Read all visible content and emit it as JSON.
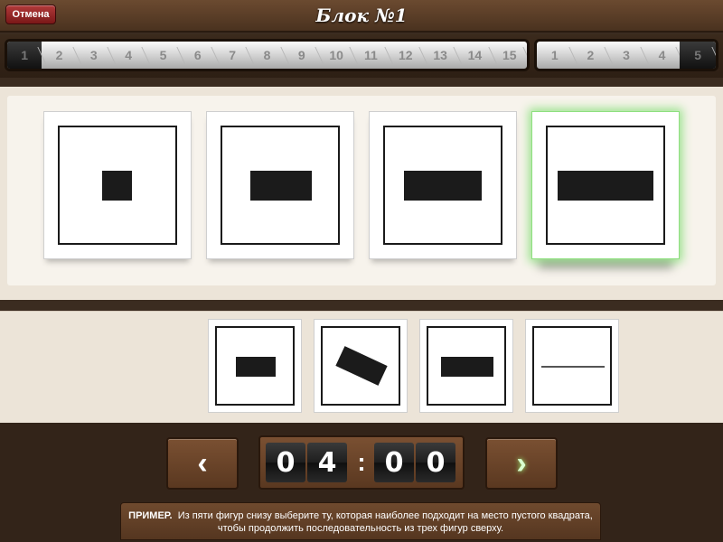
{
  "header": {
    "cancel_label": "Отмена",
    "title": "Блок №1"
  },
  "progress": {
    "main_steps": [
      "1",
      "2",
      "3",
      "4",
      "5",
      "6",
      "7",
      "8",
      "9",
      "10",
      "11",
      "12",
      "13",
      "14",
      "15"
    ],
    "main_active_index": 0,
    "sub_steps": [
      "1",
      "2",
      "3",
      "4",
      "5"
    ],
    "sub_active_index": 4
  },
  "sequence": {
    "highlighted_index": 3
  },
  "timer": {
    "d1": "0",
    "d2": "4",
    "colon": ":",
    "d3": "0",
    "d4": "0"
  },
  "nav": {
    "prev_symbol": "‹",
    "next_symbol": "›"
  },
  "hint": {
    "prefix": "ПРИМЕР.",
    "text": "Из пяти фигур снизу выберите ту, которая наиболее подходит на место пустого квадрата, чтобы продолжить последовательность из трех фигур сверху."
  },
  "icons": {
    "prev": "chevron-left-icon",
    "next": "chevron-right-icon"
  }
}
